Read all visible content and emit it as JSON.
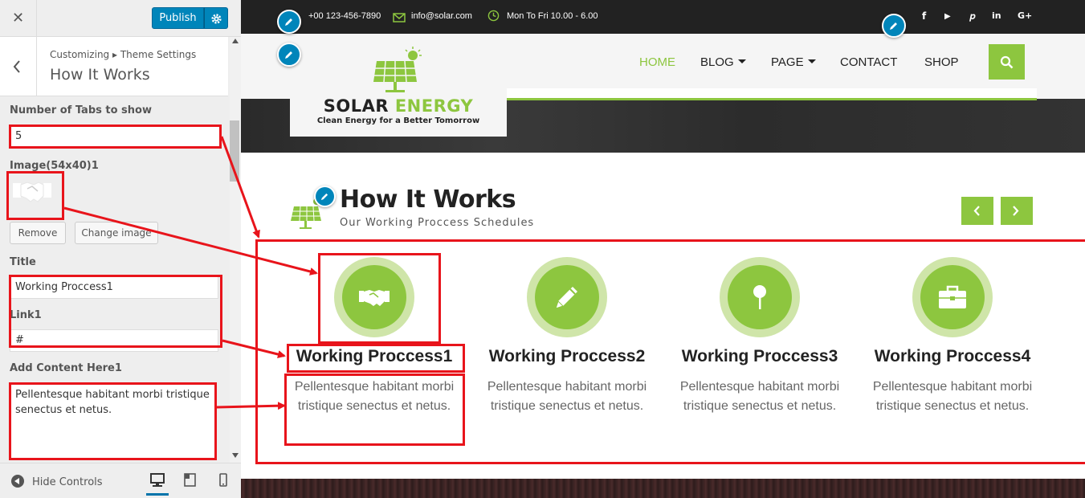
{
  "customizer": {
    "close_glyph": "✕",
    "publish_label": "Publish",
    "breadcrumb": "Customizing ▸ Theme Settings",
    "section_title": "How It Works",
    "tabs_label": "Number of Tabs to show",
    "tabs_value": "5",
    "image_label": "Image(54x40)1",
    "remove_label": "Remove",
    "change_image_label": "Change image",
    "title_label": "Title",
    "title_value": "Working Proccess1",
    "link_label": "Link1",
    "link_value": "#",
    "content_label": "Add Content Here1",
    "content_value": "Pellentesque habitant morbi tristique senectus et netus.",
    "hide_controls_label": "Hide Controls",
    "accent_color": "#0085ba"
  },
  "preview": {
    "topbar": {
      "phone": "+00 123-456-7890",
      "email": "info@solar.com",
      "hours": "Mon To Fri 10.00 - 6.00",
      "social_icons": [
        "twitter-icon",
        "facebook-icon",
        "youtube-icon",
        "pinterest-icon",
        "linkedin-icon",
        "google-plus-icon"
      ],
      "social": {
        "facebook": "f",
        "youtube": "▶",
        "pinterest": "𝒑",
        "linkedin": "in",
        "google": "G+"
      }
    },
    "logo": {
      "title_main": "SOLAR ",
      "title_accent": "ENERGY",
      "tagline": "Clean Energy for a Better Tomorrow"
    },
    "nav": [
      {
        "label": "HOME",
        "active": true
      },
      {
        "label": "BLOG",
        "dropdown": true
      },
      {
        "label": "PAGE",
        "dropdown": true
      },
      {
        "label": "CONTACT"
      },
      {
        "label": "SHOP"
      }
    ],
    "section": {
      "title": "How It Works",
      "subtitle": "Our Working Proccess Schedules"
    },
    "steps": [
      {
        "title": "Working Proccess1",
        "text": "Pellentesque habitant morbi tristique senectus et netus.",
        "icon": "handshake-icon"
      },
      {
        "title": "Working Proccess2",
        "text": "Pellentesque habitant morbi tristique senectus et netus.",
        "icon": "pencil-icon"
      },
      {
        "title": "Working Proccess3",
        "text": "Pellentesque habitant morbi tristique senectus et netus.",
        "icon": "pin-icon"
      },
      {
        "title": "Working Proccess4",
        "text": "Pellentesque habitant morbi tristique senectus et netus.",
        "icon": "briefcase-icon"
      }
    ],
    "brand_green": "#8dc63f",
    "light_green": "#cfe5a9",
    "annotation_color": "#e8141b"
  }
}
